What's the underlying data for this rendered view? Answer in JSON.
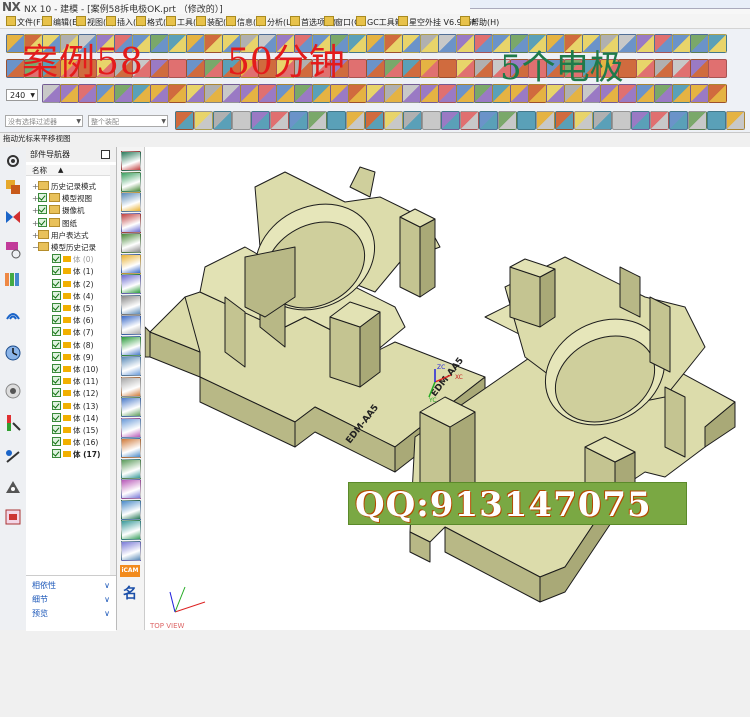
{
  "window": {
    "logo": "NX",
    "title": "NX 10 - 建模 - [案例58拆电极OK.prt （修改的）]"
  },
  "menu": [
    {
      "label": "文件(F)"
    },
    {
      "label": "编辑(E)"
    },
    {
      "label": "视图(V)"
    },
    {
      "label": "插入(S)"
    },
    {
      "label": "格式(R)"
    },
    {
      "label": "工具(T)"
    },
    {
      "label": "装配(A)"
    },
    {
      "label": "信息(I)"
    },
    {
      "label": "分析(L)"
    },
    {
      "label": "首选项(P)"
    },
    {
      "label": "窗口(O)"
    },
    {
      "label": "GC工具箱"
    },
    {
      "label": "星空外挂 V6.935F"
    },
    {
      "label": "帮助(H)"
    }
  ],
  "overlay": {
    "title": "案例58",
    "time": "50分钟",
    "count": "5个电极"
  },
  "toolbar": {
    "scale_value": "240",
    "filter_placeholder": "没有选择过滤器",
    "assembly_filter": "整个装配"
  },
  "status_line": "拖动光标来平移视图",
  "navigator": {
    "title": "部件导航器",
    "column_name": "名称",
    "items": [
      {
        "label": "历史记录模式",
        "indent": 1,
        "icon": "history-icon"
      },
      {
        "label": "模型视图",
        "indent": 1,
        "icon": "model-view-icon"
      },
      {
        "label": "摄像机",
        "indent": 1,
        "icon": "camera-icon"
      },
      {
        "label": "图纸",
        "indent": 1,
        "icon": "drawing-icon"
      },
      {
        "label": "用户表达式",
        "indent": 1,
        "icon": "folder-icon"
      },
      {
        "label": "模型历史记录",
        "indent": 1,
        "icon": "folder-icon"
      },
      {
        "label": "体 (0)",
        "indent": 2
      },
      {
        "label": "体 (1)",
        "indent": 2
      },
      {
        "label": "体 (2)",
        "indent": 2
      },
      {
        "label": "体 (4)",
        "indent": 2
      },
      {
        "label": "体 (5)",
        "indent": 2
      },
      {
        "label": "体 (6)",
        "indent": 2
      },
      {
        "label": "体 (7)",
        "indent": 2
      },
      {
        "label": "体 (8)",
        "indent": 2
      },
      {
        "label": "体 (9)",
        "indent": 2
      },
      {
        "label": "体 (10)",
        "indent": 2
      },
      {
        "label": "体 (11)",
        "indent": 2
      },
      {
        "label": "体 (12)",
        "indent": 2
      },
      {
        "label": "体 (13)",
        "indent": 2
      },
      {
        "label": "体 (14)",
        "indent": 2
      },
      {
        "label": "体 (15)",
        "indent": 2
      },
      {
        "label": "体 (16)",
        "indent": 2
      },
      {
        "label": "体 (17)",
        "indent": 2,
        "bold": true
      }
    ],
    "bottom_tabs": [
      {
        "label": "相依性"
      },
      {
        "label": "细节"
      },
      {
        "label": "预览"
      }
    ]
  },
  "vtoolbar": {
    "icam_label": "iCAM",
    "name_label": "名"
  },
  "viewport": {
    "engraving_left": "EDM-AA5",
    "engraving_right": "EDM-AA5",
    "triad_x": "XC",
    "triad_y": "YC",
    "triad_z": "ZC",
    "view_name": "TOP VIEW",
    "qq": "QQ:913147075"
  },
  "colors": {
    "model_face": "#dcdcab",
    "model_side": "#b8b886",
    "model_edge": "#1c1c1c",
    "overlay_red": "#e41b1b",
    "overlay_green": "#1f7a4a",
    "qq_bg": "#7aa843"
  }
}
